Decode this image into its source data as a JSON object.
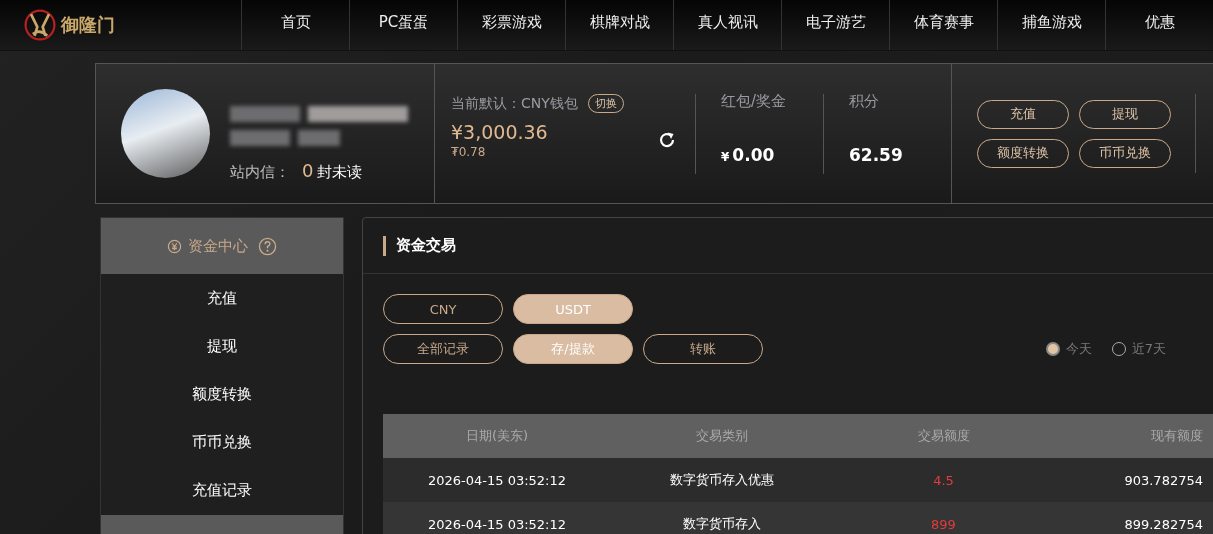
{
  "header": {
    "logo_text": "御隆门",
    "nav": [
      {
        "label": "首页"
      },
      {
        "label": "PC蛋蛋"
      },
      {
        "label": "彩票游戏"
      },
      {
        "label": "棋牌对战"
      },
      {
        "label": "真人视讯"
      },
      {
        "label": "电子游艺"
      },
      {
        "label": "体育赛事"
      },
      {
        "label": "捕鱼游戏"
      },
      {
        "label": "优惠"
      }
    ]
  },
  "account": {
    "messages_label": "站内信：",
    "unread_count": "0",
    "unread_suffix": "封未读",
    "wallet_label": "当前默认：CNY钱包",
    "switch_button": "切换",
    "balance": "¥3,000.36",
    "balance_sub": "₮0.78",
    "bonus_label": "红包/奖金",
    "bonus_currency": "¥",
    "bonus_value": "0.00",
    "points_label": "积分",
    "points_value": "62.59",
    "actions": [
      "充值",
      "提现",
      "额度转换",
      "币币兑换"
    ]
  },
  "sidebar": {
    "title": "资金中心",
    "items": [
      {
        "label": "充值"
      },
      {
        "label": "提现"
      },
      {
        "label": "额度转换"
      },
      {
        "label": "币币兑换"
      },
      {
        "label": "充值记录"
      }
    ]
  },
  "panel": {
    "title": "资金交易",
    "currency_tabs": [
      {
        "label": "CNY",
        "selected": false
      },
      {
        "label": "USDT",
        "selected": true
      }
    ],
    "record_tabs": [
      {
        "label": "全部记录",
        "selected": false
      },
      {
        "label": "存/提款",
        "selected": true
      },
      {
        "label": "转账",
        "selected": false
      }
    ],
    "range": [
      {
        "label": "今天",
        "selected": true
      },
      {
        "label": "近7天",
        "selected": false
      }
    ],
    "table": {
      "columns": [
        "日期(美东)",
        "交易类别",
        "交易额度",
        "现有额度"
      ],
      "rows": [
        [
          "2026-04-15 03:52:12",
          "数字货币存入优惠",
          "4.5",
          "903.782754"
        ],
        [
          "2026-04-15 03:52:12",
          "数字货币存入",
          "899",
          "899.282754"
        ]
      ]
    }
  }
}
